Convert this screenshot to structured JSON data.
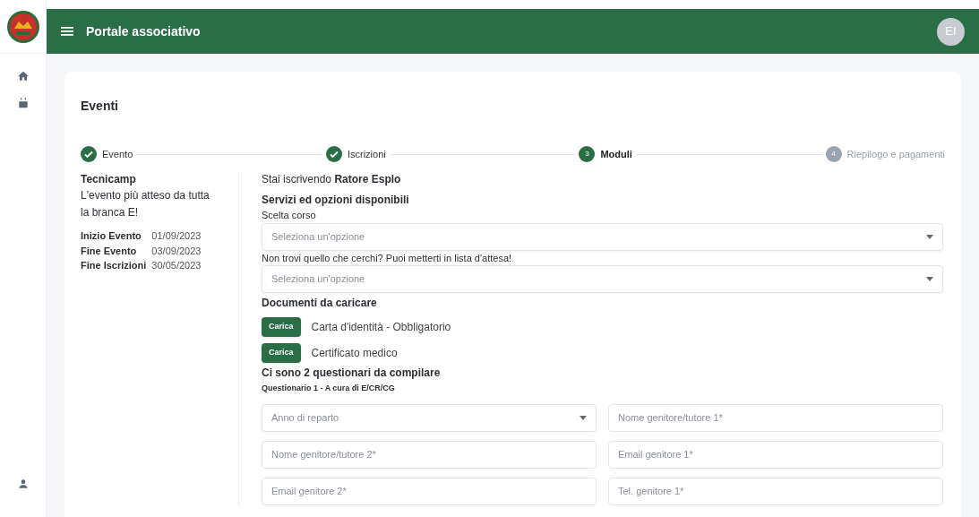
{
  "header": {
    "title": "Portale associativo",
    "avatar": "EI"
  },
  "sidebar": {
    "items": [
      {
        "kind": "home"
      },
      {
        "kind": "calendar"
      }
    ],
    "bottom": {
      "kind": "user"
    }
  },
  "page": {
    "title": "Eventi"
  },
  "steps": [
    {
      "label": "Evento",
      "completed": true,
      "active": false
    },
    {
      "label": "Iscrizioni",
      "completed": true,
      "active": false
    },
    {
      "label": "Moduli",
      "number": "3",
      "completed": false,
      "active": true
    },
    {
      "label": "Riepilogo e pagamenti",
      "number": "4",
      "completed": false,
      "active": false
    }
  ],
  "event": {
    "name": "Tecnicamp",
    "description": "L'evento più atteso da tutta la branca E!",
    "dates": [
      {
        "label": "Inizio Evento",
        "value": "01/09/2023"
      },
      {
        "label": "Fine Evento",
        "value": "03/09/2023"
      },
      {
        "label": "Fine Iscrizioni",
        "value": "30/05/2023"
      }
    ]
  },
  "form": {
    "enrolling": "Stai iscrivendo **Ratore Esplo**",
    "services_title": "Servizi ed opzioni disponibili",
    "course_label": "Scelta corso",
    "course_select": {
      "placeholder": "Seleziona un'opzione"
    },
    "waitlist_label": "Non trovi quello che cerchi? Puoi metterti in lista d'attesa!",
    "waitlist_select": {
      "placeholder": "Seleziona un'opzione"
    },
    "documents_title": "Documenti da caricare",
    "documents": [
      {
        "button": "Carica",
        "label": "Carta d'identità - Obbligatorio"
      },
      {
        "button": "Carica",
        "label": "Certificato medico"
      }
    ],
    "questionnaires_title": "Ci sono 2 questionari da compilare",
    "questionnaire_title": "Questionario 1 - A cura di E/CR/CG",
    "fields": [
      {
        "kind": "select",
        "placeholder": "Anno di reparto"
      },
      {
        "kind": "text",
        "placeholder": "Nome genitore/tutore 1*"
      },
      {
        "kind": "text",
        "placeholder": "Nome genitore/tutore 2*"
      },
      {
        "kind": "text",
        "placeholder": "Email genitore 1*"
      },
      {
        "kind": "text",
        "placeholder": "Email genitore 2*"
      },
      {
        "kind": "text",
        "placeholder": "Tel. genitore 1*"
      }
    ]
  }
}
